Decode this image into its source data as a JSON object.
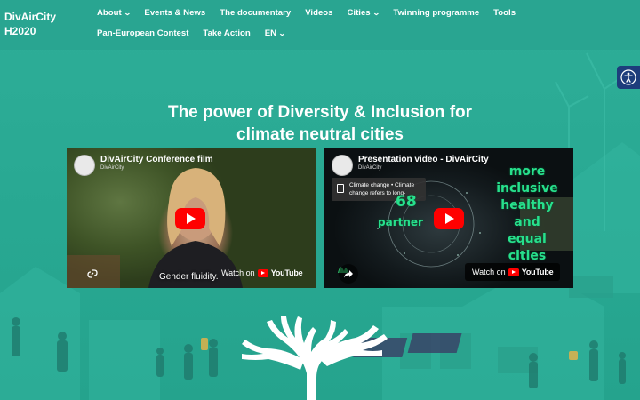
{
  "site": {
    "logo_line1": "DivAirCity",
    "logo_line2": "H2020"
  },
  "nav": {
    "items": [
      {
        "label": "About",
        "has_dropdown": true
      },
      {
        "label": "Events & News",
        "has_dropdown": false
      },
      {
        "label": "The documentary",
        "has_dropdown": false
      },
      {
        "label": "Videos",
        "has_dropdown": false
      },
      {
        "label": "Cities",
        "has_dropdown": true
      },
      {
        "label": "Twinning programme",
        "has_dropdown": false
      },
      {
        "label": "Tools",
        "has_dropdown": false
      },
      {
        "label": "Pan-European Contest",
        "has_dropdown": false
      },
      {
        "label": "Take Action",
        "has_dropdown": false
      },
      {
        "label": "EN",
        "has_dropdown": true
      }
    ],
    "chevron_glyph": "⌄"
  },
  "hero": {
    "title_line1": "The power of Diversity & Inclusion for",
    "title_line2": "climate neutral cities"
  },
  "videos": [
    {
      "title": "DivAirCity Conference film",
      "channel": "DivAirCity",
      "caption": "Gender fluidity.",
      "watch_on": "Watch on",
      "brand": "YouTube"
    },
    {
      "title": "Presentation video - DivAirCity",
      "channel": "DivAirCity",
      "watch_on": "Watch on",
      "brand": "YouTube",
      "card_text": "Climate change • Climate change refers to long-",
      "overlay_words": [
        "more",
        "inclusive",
        "healthy",
        "and",
        "equal",
        "cities"
      ],
      "overlay_number": "68",
      "overlay_partner": "partner"
    }
  ],
  "colors": {
    "background": "#2bab96",
    "header": "#29a591",
    "accessibility_button": "#1d3d7c",
    "youtube_red": "#ff0000",
    "overlay_green": "#27e08c"
  },
  "icons": {
    "accessibility": "accessibility-icon",
    "play": "play-icon",
    "share": "share-icon",
    "link": "link-icon"
  }
}
